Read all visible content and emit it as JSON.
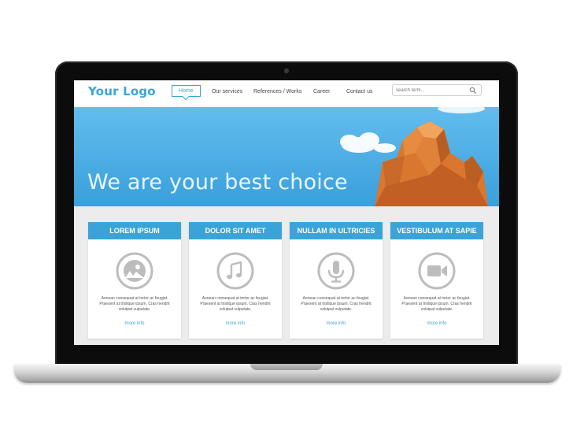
{
  "site": {
    "logo": "Your Logo",
    "nav": [
      {
        "label": "Home",
        "active": true
      },
      {
        "label": "Our services",
        "active": false
      },
      {
        "label": "References / Works",
        "active": false
      },
      {
        "label": "Career",
        "active": false
      },
      {
        "label": "Contact us",
        "active": false
      }
    ],
    "search": {
      "placeholder": "search term..."
    },
    "hero": {
      "title": "We are your best choice"
    },
    "cards": [
      {
        "title": "LOREM IPSUM",
        "icon": "image-icon",
        "text": "Aenean consequat at tortor ac feugiat. Praesent at tristique ipsum. Cras hendrit volutpat vulputate.",
        "link": "more info"
      },
      {
        "title": "DOLOR SIT AMET",
        "icon": "music-icon",
        "text": "Aenean consequat at tortor ac feugiat. Praesent at tristique ipsum. Cras hendrit volutpat vulputate.",
        "link": "more info"
      },
      {
        "title": "NULLAM IN ULTRICIES",
        "icon": "microphone-icon",
        "text": "Aenean consequat at tortor ac feugiat. Praesent at tristique ipsum. Cras hendrit volutpat vulputate.",
        "link": "more info"
      },
      {
        "title": "VESTIBULUM AT SAPIE",
        "icon": "video-camera-icon",
        "text": "Aenean consequat at tortor ac feugiat. Praesent at tristique ipsum. Cras hendrit volutpat vulputate.",
        "link": "more info"
      }
    ]
  },
  "colors": {
    "accent": "#3aa4d9",
    "hero_sky": "#4aaee3",
    "card_icon": "#bdbdbd",
    "rock": "#d9772e"
  }
}
